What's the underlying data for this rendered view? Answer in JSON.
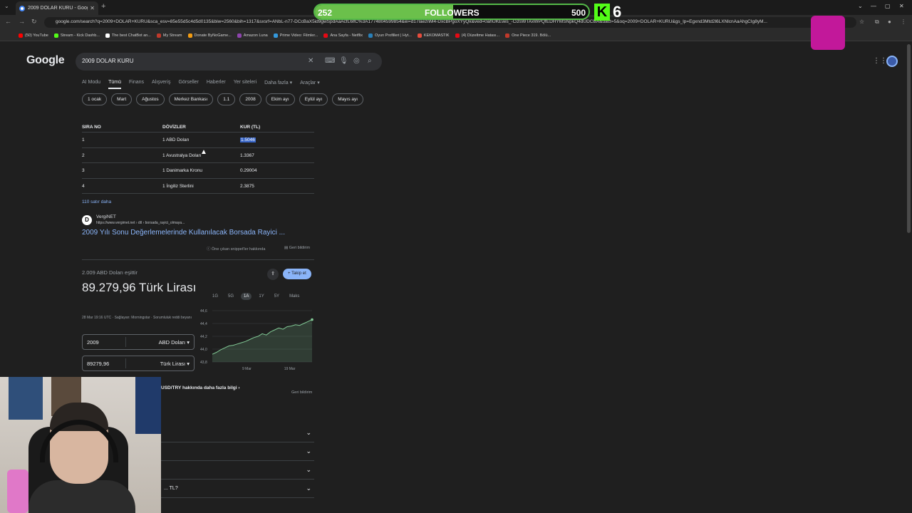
{
  "browser": {
    "tab_title": "2009 DOLAR KURU - Google'da",
    "url": "google.com/search?q=2009+DOLAR+KURU&sca_esv=85e55d5c4d5d0135&biw=2560&bih=1317&sxsrf=ANbL-n77-DCcBaX5id9gwSpdAaAcfL6lfC%3A1774804599854&ei=d17laeznM4-DxcBPgoXYyQk&ved=0ahUKEwis_-CizsWTAxWPQfEDHYMSNpkQ4dUDCBA&uact=5&oq=2009+DOLAR+KURU&gs_lp=Egxnd3Mtd2l6LXNlcnAaAhgCIg8yM...",
    "bookmarks": [
      {
        "label": "(50) YouTube",
        "color": "#ff0000"
      },
      {
        "label": "Stream - Kick Dashb...",
        "color": "#53fc18"
      },
      {
        "label": "The best ChatBot an...",
        "color": "#ffffff"
      },
      {
        "label": "My Stream",
        "color": "#c0392b"
      },
      {
        "label": "Donate ByNoGame...",
        "color": "#f39c12"
      },
      {
        "label": "Amazon Luna",
        "color": "#8e44ad"
      },
      {
        "label": "Prime Video: Filmler...",
        "color": "#3498db"
      },
      {
        "label": "Ana Sayfa - Netflix",
        "color": "#e50914"
      },
      {
        "label": "Oyun Profilleri | Hyt...",
        "color": "#2980b9"
      },
      {
        "label": "KEKOMASTIK",
        "color": "#e74c3c"
      },
      {
        "label": "(4) Düzeltme Hatası...",
        "color": "#e50914"
      },
      {
        "label": "One Piece 319. Bölü...",
        "color": "#c0392b"
      }
    ]
  },
  "overlay": {
    "followers_current": "252",
    "followers_label": "FOLLOWERS",
    "followers_goal": "500",
    "followers_progress": 0.504,
    "kick_count": "6"
  },
  "google": {
    "logo": "Google",
    "query": "2009 DOLAR KURU",
    "tabs": [
      "AI Modu",
      "Tümü",
      "Finans",
      "Alışveriş",
      "Görseller",
      "Haberler",
      "Yer siteleri",
      "Daha fazla ▾",
      "Araçlar ▾"
    ],
    "active_tab": "Tümü",
    "chips": [
      "1 ocak",
      "Mart",
      "Ağustos",
      "Merkez Bankası",
      "1.1",
      "2008",
      "Ekim ayı",
      "Eylül ayı",
      "Mayıs ayı"
    ]
  },
  "table": {
    "headers": [
      "SIRA NO",
      "DÖVİZLER",
      "KUR (TL)"
    ],
    "rows": [
      [
        "1",
        "1 ABD Doları",
        "1.5046"
      ],
      [
        "2",
        "1 Avustralya Doları",
        "1.3367"
      ],
      [
        "3",
        "1 Danimarka Kronu",
        "0.29004"
      ],
      [
        "4",
        "1 İngiliz Sterlini",
        "2.3875"
      ]
    ],
    "more_rows": "110 satır daha"
  },
  "source": {
    "icon_letter": "D",
    "name": "VergiNET",
    "url": "https://www.vergimet.net › dtl › borsada_rayici_olmaya...",
    "title": "2009 Yılı Sonu Değerlemelerinde Kullanılacak Borsada Rayici ...",
    "about_snippets": "Öne çıkan snippet'ler hakkında",
    "feedback": "Geri bildirim"
  },
  "converter": {
    "subtitle": "2.009 ABD Doları eşittir",
    "result": "89.279,96 Türk Lirası",
    "meta": "28 Mar 19:16 UTC · Sağlayan: Morningstar · Sorumluluk reddi beyanı",
    "follow_label": "+ Takip et",
    "periods": [
      "1G",
      "5G",
      "1A",
      "1Y",
      "5Y",
      "Maks"
    ],
    "active_period": "1A",
    "from_value": "2009",
    "from_currency": "ABD Doları",
    "to_value": "89279,96",
    "to_currency": "Türk Lirası",
    "more_info": "USD/TRY hakkında daha fazla bilgi",
    "feedback": "Geri bildirim"
  },
  "faq": [
    "",
    "",
    "",
    "... TL?"
  ],
  "colors": {
    "page_bg": "#1f1f1f",
    "link": "#8ab4f8",
    "highlight": "#3764c6",
    "chart_line": "#81c995",
    "kick_green": "#53fc18"
  },
  "chart_data": {
    "type": "area",
    "title": "",
    "xlabel": "",
    "ylabel": "",
    "x_ticks": [
      "9 Mar",
      "19 Mar"
    ],
    "y_ticks": [
      43.8,
      44.0,
      44.2,
      44.4,
      44.6
    ],
    "ylim": [
      43.8,
      44.6
    ],
    "grid": true,
    "series": [
      {
        "values": [
          43.92,
          43.95,
          43.99,
          44.02,
          44.05,
          44.06,
          44.08,
          44.1,
          44.12,
          44.15,
          44.18,
          44.2,
          44.24,
          44.22,
          44.27,
          44.3,
          44.33,
          44.31,
          44.35,
          44.36,
          44.38,
          44.37,
          44.4,
          44.43,
          44.46
        ]
      }
    ]
  }
}
